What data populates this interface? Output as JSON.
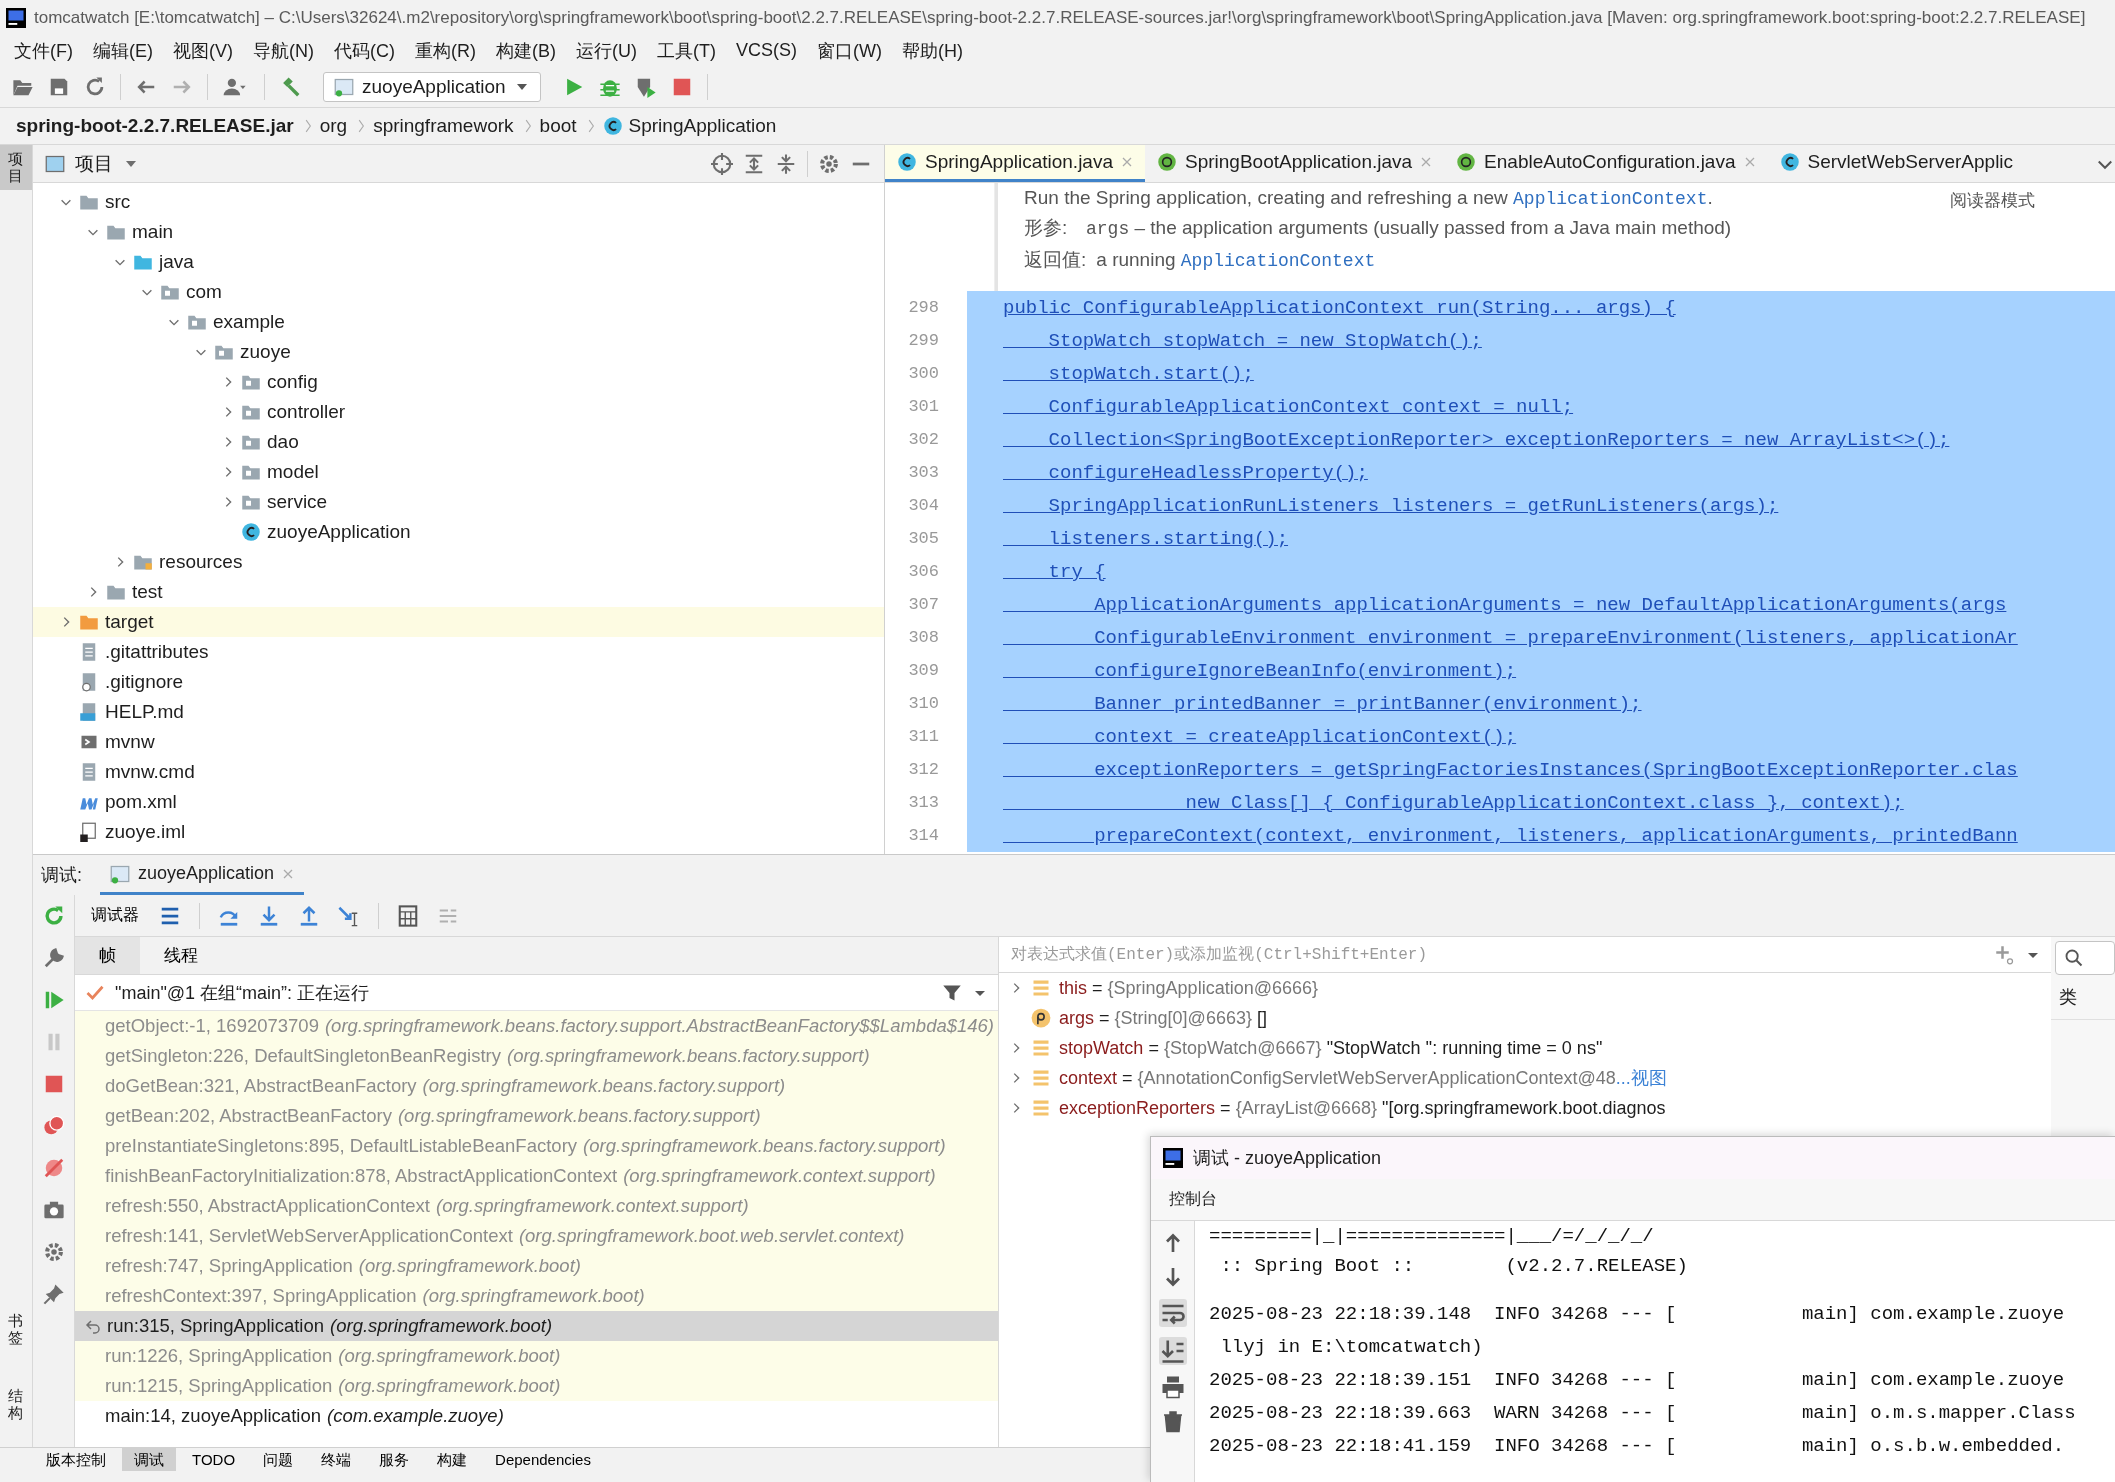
{
  "window": {
    "title": "tomcatwatch [E:\\tomcatwatch] – C:\\Users\\32624\\.m2\\repository\\org\\springframework\\boot\\spring-boot\\2.2.7.RELEASE\\spring-boot-2.2.7.RELEASE-sources.jar!\\org\\springframework\\boot\\SpringApplication.java [Maven: org.springframework.boot:spring-boot:2.2.7.RELEASE]"
  },
  "menu": [
    "文件(F)",
    "编辑(E)",
    "视图(V)",
    "导航(N)",
    "代码(C)",
    "重构(R)",
    "构建(B)",
    "运行(U)",
    "工具(T)",
    "VCS(S)",
    "窗口(W)",
    "帮助(H)"
  ],
  "toolbar": {
    "run_config": "zuoyeApplication"
  },
  "breadcrumb": [
    {
      "label": "spring-boot-2.2.7.RELEASE.jar",
      "kind": "jar"
    },
    {
      "label": "org",
      "kind": "package"
    },
    {
      "label": "springframework",
      "kind": "package"
    },
    {
      "label": "boot",
      "kind": "package"
    },
    {
      "label": "SpringApplication",
      "kind": "class"
    }
  ],
  "side_strip": {
    "top": [
      "项目"
    ],
    "bottom": [
      "书签",
      "结构"
    ]
  },
  "project": {
    "title": "项目",
    "tree": [
      {
        "label": "src",
        "kind": "folder",
        "expanded": true,
        "children": [
          {
            "label": "main",
            "kind": "folder",
            "expanded": true,
            "children": [
              {
                "label": "java",
                "kind": "source",
                "expanded": true,
                "children": [
                  {
                    "label": "com",
                    "kind": "package",
                    "expanded": true,
                    "children": [
                      {
                        "label": "example",
                        "kind": "package",
                        "expanded": true,
                        "children": [
                          {
                            "label": "zuoye",
                            "kind": "package",
                            "expanded": true,
                            "children": [
                              {
                                "label": "config",
                                "kind": "package",
                                "expanded": false
                              },
                              {
                                "label": "controller",
                                "kind": "package",
                                "expanded": false
                              },
                              {
                                "label": "dao",
                                "kind": "package",
                                "expanded": false
                              },
                              {
                                "label": "model",
                                "kind": "package",
                                "expanded": false
                              },
                              {
                                "label": "service",
                                "kind": "package",
                                "expanded": false
                              },
                              {
                                "label": "zuoyeApplication",
                                "kind": "class"
                              }
                            ]
                          }
                        ]
                      }
                    ]
                  }
                ]
              },
              {
                "label": "resources",
                "kind": "resources",
                "expanded": false
              }
            ]
          },
          {
            "label": "test",
            "kind": "folder",
            "expanded": false
          }
        ]
      },
      {
        "label": "target",
        "kind": "excluded",
        "expanded": false
      },
      {
        "label": ".gitattributes",
        "kind": "text"
      },
      {
        "label": ".gitignore",
        "kind": "ignore"
      },
      {
        "label": "HELP.md",
        "kind": "markdown"
      },
      {
        "label": "mvnw",
        "kind": "script"
      },
      {
        "label": "mvnw.cmd",
        "kind": "text"
      },
      {
        "label": "pom.xml",
        "kind": "maven"
      },
      {
        "label": "zuoye.iml",
        "kind": "module"
      }
    ]
  },
  "editor": {
    "tabs": [
      {
        "label": "SpringApplication.java",
        "kind": "class",
        "selected": true
      },
      {
        "label": "SpringBootApplication.java",
        "kind": "annotation",
        "selected": false
      },
      {
        "label": "EnableAutoConfiguration.java",
        "kind": "annotation",
        "selected": false
      },
      {
        "label": "ServletWebServerApplic",
        "kind": "class",
        "selected": false
      }
    ],
    "reader_mode": "阅读器模式",
    "doc": [
      {
        "segments": [
          {
            "text": "Run the Spring application, creating and refreshing a new ",
            "kind": "text"
          },
          {
            "text": "ApplicationContext",
            "kind": "code"
          },
          {
            "text": ".",
            "kind": "text"
          }
        ]
      },
      {
        "label": "形参:",
        "segments": [
          {
            "text": "args",
            "kind": "param"
          },
          {
            "text": " – the application arguments (usually passed from a Java main method)",
            "kind": "text"
          }
        ]
      },
      {
        "label": "返回值:",
        "segments": [
          {
            "text": "a running ",
            "kind": "text"
          },
          {
            "text": "ApplicationContext",
            "kind": "code"
          }
        ]
      }
    ],
    "lines": [
      {
        "number": "298",
        "text": "public ConfigurableApplicationContext run(String... args) {",
        "selected": true
      },
      {
        "number": "299",
        "text": "    StopWatch stopWatch = new StopWatch();",
        "selected": true
      },
      {
        "number": "300",
        "text": "    stopWatch.start();",
        "selected": true
      },
      {
        "number": "301",
        "text": "    ConfigurableApplicationContext context = null;",
        "selected": true
      },
      {
        "number": "302",
        "text": "    Collection<SpringBootExceptionReporter> exceptionReporters = new ArrayList<>();",
        "selected": true
      },
      {
        "number": "303",
        "text": "    configureHeadlessProperty();",
        "selected": true
      },
      {
        "number": "304",
        "text": "    SpringApplicationRunListeners listeners = getRunListeners(args);",
        "selected": true
      },
      {
        "number": "305",
        "text": "    listeners.starting();",
        "selected": true
      },
      {
        "number": "306",
        "text": "    try {",
        "selected": true
      },
      {
        "number": "307",
        "text": "        ApplicationArguments applicationArguments = new DefaultApplicationArguments(args",
        "selected": true
      },
      {
        "number": "308",
        "text": "        ConfigurableEnvironment environment = prepareEnvironment(listeners, applicationAr",
        "selected": true
      },
      {
        "number": "309",
        "text": "        configureIgnoreBeanInfo(environment);",
        "selected": true
      },
      {
        "number": "310",
        "text": "        Banner printedBanner = printBanner(environment);",
        "selected": true
      },
      {
        "number": "311",
        "text": "        context = createApplicationContext();",
        "selected": true
      },
      {
        "number": "312",
        "text": "        exceptionReporters = getSpringFactoriesInstances(SpringBootExceptionReporter.clas",
        "selected": true
      },
      {
        "number": "313",
        "text": "                new Class[] { ConfigurableApplicationContext.class }, context);",
        "selected": true
      },
      {
        "number": "314",
        "text": "        prepareContext(context, environment, listeners, applicationArguments, printedBann",
        "selected": true
      }
    ]
  },
  "debug": {
    "label": "调试:",
    "session_tab": "zuoyeApplication",
    "debugger_button": "调试器",
    "tabs": [
      {
        "label": "帧",
        "selected": true
      },
      {
        "label": "线程",
        "selected": false
      }
    ],
    "thread": "\"main\"@1 在组“main”: 正在运行",
    "frames": [
      {
        "method": "getObject:-1, 1692073709",
        "package": "(org.springframework.beans.factory.support.AbstractBeanFactory$$Lambda$146)",
        "kind": "library",
        "selected": false
      },
      {
        "method": "getSingleton:226, DefaultSingletonBeanRegistry",
        "package": "(org.springframework.beans.factory.support)",
        "kind": "library",
        "selected": false
      },
      {
        "method": "doGetBean:321, AbstractBeanFactory",
        "package": "(org.springframework.beans.factory.support)",
        "kind": "library",
        "selected": false
      },
      {
        "method": "getBean:202, AbstractBeanFactory",
        "package": "(org.springframework.beans.factory.support)",
        "kind": "library",
        "selected": false
      },
      {
        "method": "preInstantiateSingletons:895, DefaultListableBeanFactory",
        "package": "(org.springframework.beans.factory.support)",
        "kind": "library",
        "selected": false
      },
      {
        "method": "finishBeanFactoryInitialization:878, AbstractApplicationContext",
        "package": "(org.springframework.context.support)",
        "kind": "library",
        "selected": false
      },
      {
        "method": "refresh:550, AbstractApplicationContext",
        "package": "(org.springframework.context.support)",
        "kind": "library",
        "selected": false
      },
      {
        "method": "refresh:141, ServletWebServerApplicationContext",
        "package": "(org.springframework.boot.web.servlet.context)",
        "kind": "library",
        "selected": false
      },
      {
        "method": "refresh:747, SpringApplication",
        "package": "(org.springframework.boot)",
        "kind": "library",
        "selected": false
      },
      {
        "method": "refreshContext:397, SpringApplication",
        "package": "(org.springframework.boot)",
        "kind": "library",
        "selected": false
      },
      {
        "method": "run:315, SpringApplication",
        "package": "(org.springframework.boot)",
        "kind": "library",
        "selected": true
      },
      {
        "method": "run:1226, SpringApplication",
        "package": "(org.springframework.boot)",
        "kind": "library",
        "selected": false
      },
      {
        "method": "run:1215, SpringApplication",
        "package": "(org.springframework.boot)",
        "kind": "library",
        "selected": false
      },
      {
        "method": "main:14, zuoyeApplication",
        "package": "(com.example.zuoye)",
        "kind": "project",
        "selected": false
      }
    ],
    "watch": {
      "placeholder": "对表达式求值(Enter)或添加监视(Ctrl+Shift+Enter)"
    },
    "variables": [
      {
        "name": "this",
        "operator": "=",
        "value": "{SpringApplication@6666}",
        "kind": "field",
        "expandable": true
      },
      {
        "name": "args",
        "operator": "=",
        "value": "{String[0]@6663}",
        "extra": "[]",
        "kind": "param",
        "expandable": false
      },
      {
        "name": "stopWatch",
        "operator": "=",
        "value": "{StopWatch@6667}",
        "extra": "\"StopWatch '': running time = 0 ns\"",
        "kind": "field",
        "expandable": true
      },
      {
        "name": "context",
        "operator": "=",
        "value": "{AnnotationConfigServletWebServerApplicationContext@48",
        "link": "...视图",
        "kind": "field",
        "expandable": true
      },
      {
        "name": "exceptionReporters",
        "operator": "=",
        "value": "{ArrayList@6668}",
        "extra": "\"[org.springframework.boot.diagnos",
        "kind": "field",
        "expandable": true
      }
    ],
    "class_panel": {
      "label": "类"
    }
  },
  "console_window": {
    "title": "调试 - zuoyeApplication",
    "tab": "控制台",
    "lines": [
      {
        "text": "=========|_|==============|___/=/_/_/_/",
        "kind": "banner"
      },
      {
        "text": " :: Spring Boot ::        (v2.2.7.RELEASE)",
        "kind": "banner"
      },
      {
        "text": "2025-08-23 22:18:39.148  INFO 34268 --- [           main] com.example.zuoye",
        "kind": "log_start"
      },
      {
        "text": " llyj in E:\\tomcatwatch)",
        "kind": "log"
      },
      {
        "text": "2025-08-23 22:18:39.151  INFO 34268 --- [           main] com.example.zuoye",
        "kind": "log"
      },
      {
        "text": "2025-08-23 22:18:39.663  WARN 34268 --- [           main] o.m.s.mapper.Class",
        "kind": "log"
      },
      {
        "text": "2025-08-23 22:18:41.159  INFO 34268 --- [           main] o.s.b.w.embedded.",
        "kind": "log"
      }
    ]
  },
  "bottom_tools": [
    {
      "label": "版本控制",
      "selected": false
    },
    {
      "label": "调试",
      "selected": true
    },
    {
      "label": "TODO",
      "selected": false
    },
    {
      "label": "问题",
      "selected": false
    },
    {
      "label": "终端",
      "selected": false
    },
    {
      "label": "服务",
      "selected": false
    },
    {
      "label": "构建",
      "selected": false
    },
    {
      "label": "Dependencies",
      "selected": false
    }
  ]
}
